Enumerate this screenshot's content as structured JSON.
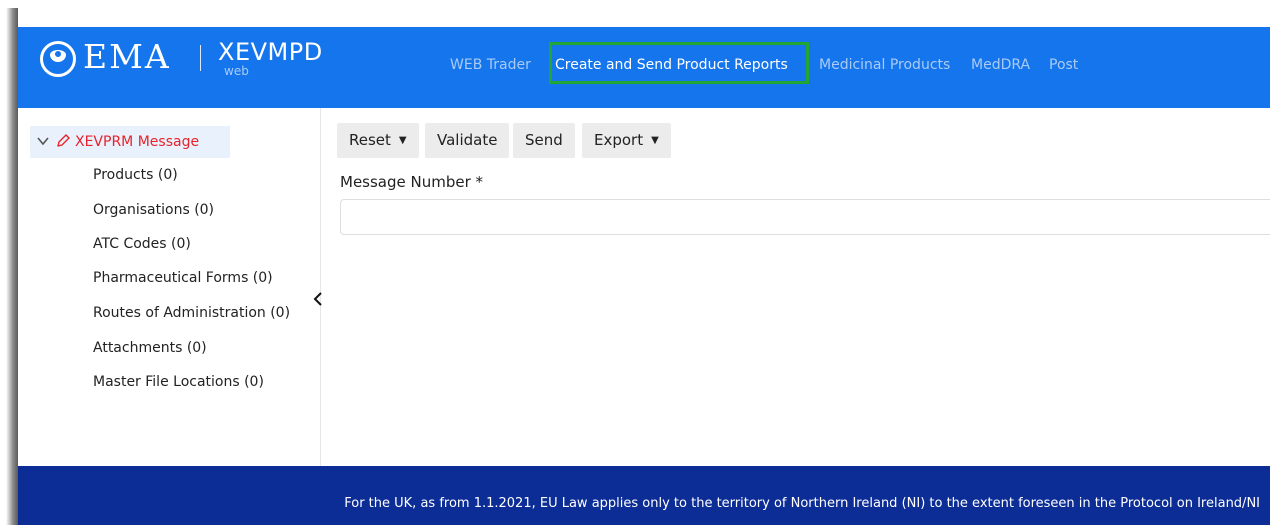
{
  "brand": {
    "logo": "EMA",
    "app_name": "XEVMPD",
    "app_sub": "web"
  },
  "nav": {
    "items": [
      {
        "label": "WEB Trader",
        "active": false
      },
      {
        "label": "Create and Send Product Reports",
        "active": true
      },
      {
        "label": "Medicinal Products",
        "active": false
      },
      {
        "label": "MedDRA",
        "active": false
      },
      {
        "label": "Post",
        "active": false
      }
    ],
    "highlight_color": "#22a535"
  },
  "sidebar": {
    "root_label": "XEVPRM Message",
    "items": [
      "Products (0)",
      "Organisations (0)",
      "ATC Codes (0)",
      "Pharmaceutical Forms (0)",
      "Routes of Administration (0)",
      "Attachments (0)",
      "Master File Locations (0)"
    ]
  },
  "toolbar": {
    "reset_label": "Reset",
    "validate_label": "Validate",
    "send_label": "Send",
    "export_label": "Export"
  },
  "form": {
    "message_number_label": "Message Number *",
    "message_number_value": ""
  },
  "footer": {
    "text": "For the UK, as from 1.1.2021, EU Law applies only to the territory of Northern Ireland (NI) to the extent foreseen in the Protocol on Ireland/NI"
  },
  "colors": {
    "header": "#1575ec",
    "footer": "#0c2d96",
    "root_text": "#e8222b",
    "nav_inactive": "#a9cbf6"
  },
  "icons": [
    "chevron-down-icon",
    "pencil-icon",
    "chevron-left-icon",
    "caret-down-icon"
  ]
}
